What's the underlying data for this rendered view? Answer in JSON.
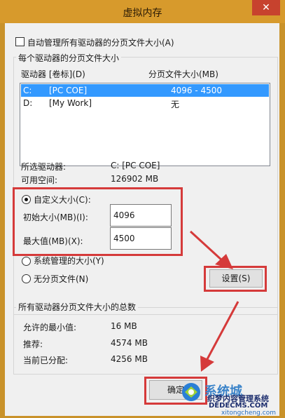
{
  "window": {
    "title": "虚拟内存",
    "close_glyph": "✕"
  },
  "auto_manage": {
    "label": "自动管理所有驱动器的分页文件大小(A)",
    "checked": false
  },
  "paging_group": {
    "title": "每个驱动器的分页文件大小",
    "col_drive": "驱动器 [卷标](D)",
    "col_size": "分页文件大小(MB)",
    "drives": [
      {
        "drive": "C:",
        "label": "[PC COE]",
        "size": "4096 - 4500",
        "selected": true
      },
      {
        "drive": "D:",
        "label": "[My Work]",
        "size": "无",
        "selected": false
      }
    ],
    "selected_drive_label": "所选驱动器:",
    "selected_drive_value": "C:  [PC COE]",
    "free_space_label": "可用空间:",
    "free_space_value": "126902 MB",
    "custom_size_label": "自定义大小(C):",
    "initial_size_label": "初始大小(MB)(I):",
    "initial_size_value": "4096",
    "max_size_label": "最大值(MB)(X):",
    "max_size_value": "4500",
    "system_managed_label": "系统管理的大小(Y)",
    "no_paging_label": "无分页文件(N)",
    "set_button": "设置(S)"
  },
  "totals_group": {
    "title": "所有驱动器分页文件大小的总数",
    "min_label": "允许的最小值:",
    "min_value": "16 MB",
    "recommended_label": "推荐:",
    "recommended_value": "4574 MB",
    "current_label": "当前已分配:",
    "current_value": "4256 MB"
  },
  "footer": {
    "ok_button": "确定"
  },
  "watermark": {
    "brand": "系统城",
    "line1": "织梦内容管理系统",
    "line2": "DEDECMS.COM",
    "line3": "xitongcheng.com"
  },
  "colors": {
    "annotation": "#d53a3a",
    "selection": "#3399ff",
    "titlebar": "#d79a2c"
  }
}
